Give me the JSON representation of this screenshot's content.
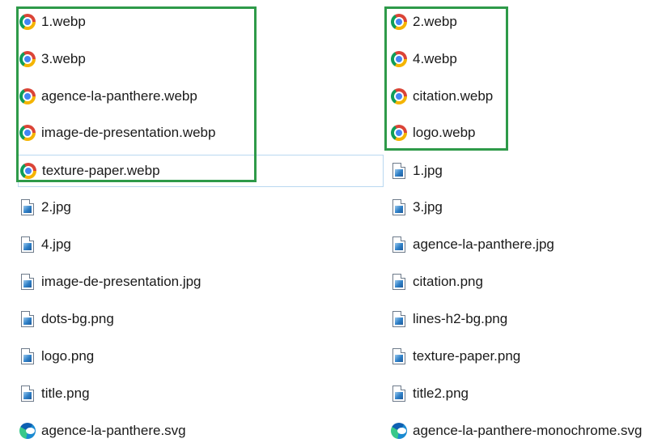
{
  "left_column": [
    {
      "name": "1.webp",
      "icon": "chrome-icon"
    },
    {
      "name": "3.webp",
      "icon": "chrome-icon"
    },
    {
      "name": "agence-la-panthere.webp",
      "icon": "chrome-icon"
    },
    {
      "name": "image-de-presentation.webp",
      "icon": "chrome-icon"
    },
    {
      "name": "texture-paper.webp",
      "icon": "chrome-icon"
    },
    {
      "name": "2.jpg",
      "icon": "image-file-icon"
    },
    {
      "name": "4.jpg",
      "icon": "image-file-icon"
    },
    {
      "name": "image-de-presentation.jpg",
      "icon": "image-file-icon"
    },
    {
      "name": "dots-bg.png",
      "icon": "image-file-icon"
    },
    {
      "name": "logo.png",
      "icon": "image-file-icon"
    },
    {
      "name": "title.png",
      "icon": "image-file-icon"
    },
    {
      "name": "agence-la-panthere.svg",
      "icon": "edge-icon"
    }
  ],
  "right_column": [
    {
      "name": "2.webp",
      "icon": "chrome-icon"
    },
    {
      "name": "4.webp",
      "icon": "chrome-icon"
    },
    {
      "name": "citation.webp",
      "icon": "chrome-icon"
    },
    {
      "name": "logo.webp",
      "icon": "chrome-icon"
    },
    {
      "name": "1.jpg",
      "icon": "image-file-icon"
    },
    {
      "name": "3.jpg",
      "icon": "image-file-icon"
    },
    {
      "name": "agence-la-panthere.jpg",
      "icon": "image-file-icon"
    },
    {
      "name": "citation.png",
      "icon": "image-file-icon"
    },
    {
      "name": "lines-h2-bg.png",
      "icon": "image-file-icon"
    },
    {
      "name": "texture-paper.png",
      "icon": "image-file-icon"
    },
    {
      "name": "title2.png",
      "icon": "image-file-icon"
    },
    {
      "name": "agence-la-panthere-monochrome.svg",
      "icon": "edge-icon"
    }
  ],
  "colors": {
    "highlight_box": "#2e9a49",
    "focus_outline": "#b9d8f0"
  }
}
